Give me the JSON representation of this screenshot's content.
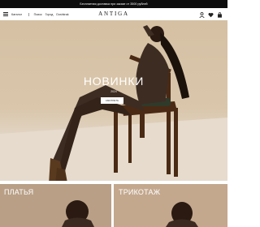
{
  "promo": {
    "text": "Бесплатная доставка при заказе от 3500 рублей"
  },
  "header": {
    "menu_label": "Каталог",
    "links": [
      "Поиск",
      "Город",
      "Doshkrak"
    ],
    "logo": "ANTIGA",
    "icons": [
      "user-icon",
      "heart-icon",
      "bag-icon"
    ]
  },
  "hero": {
    "title": "НОВИНКИ",
    "subtitle": "2024",
    "button_label": "СМОТРЕТЬ"
  },
  "categories": [
    {
      "label": "ПЛАТЬЯ"
    },
    {
      "label": "ТРИКОТАЖ"
    }
  ],
  "colors": {
    "promo_bg": "#0d0d0d",
    "hero_wall": "#d5c0a3",
    "chair": "#4a2a14",
    "outfit": "#3d2c22"
  }
}
